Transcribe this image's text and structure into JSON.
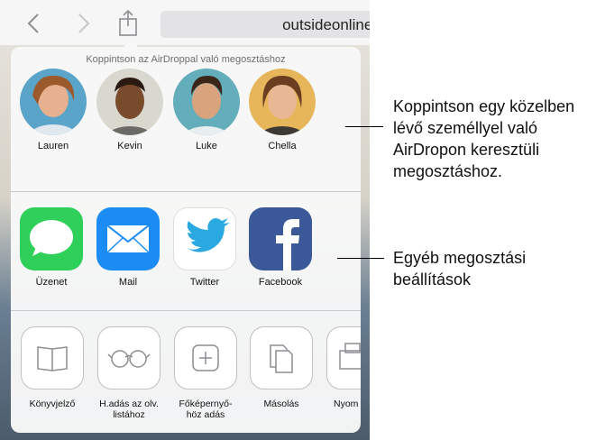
{
  "toolbar": {
    "url": "outsideonline.",
    "back_icon": "chevron-left-icon",
    "forward_icon": "chevron-right-icon",
    "share_icon": "share-icon"
  },
  "share_sheet": {
    "airdrop_hint": "Koppintson az AirDroppal való megosztáshoz",
    "people": [
      {
        "name": "Lauren"
      },
      {
        "name": "Kevin"
      },
      {
        "name": "Luke"
      },
      {
        "name": "Chella"
      }
    ],
    "apps": [
      {
        "label": "Üzenet",
        "icon": "messages-icon"
      },
      {
        "label": "Mail",
        "icon": "mail-icon"
      },
      {
        "label": "Twitter",
        "icon": "twitter-icon"
      },
      {
        "label": "Facebook",
        "icon": "facebook-icon"
      }
    ],
    "actions": [
      {
        "line1": "Könyvjelző",
        "line2": "",
        "icon": "book-icon"
      },
      {
        "line1": "H.adás az olv.",
        "line2": "listához",
        "icon": "glasses-icon"
      },
      {
        "line1": "Főképernyő-",
        "line2": "höz adás",
        "icon": "plus-square-icon"
      },
      {
        "line1": "Másolás",
        "line2": "",
        "icon": "copy-icon"
      },
      {
        "line1": "Nyom",
        "line2": "",
        "icon": "print-icon"
      }
    ]
  },
  "callouts": {
    "airdrop": [
      "Koppintson egy közelben",
      "lévő személlyel való",
      "AirDropon keresztüli",
      "megosztáshoz."
    ],
    "other": [
      "Egyéb megosztási",
      "beállítások"
    ]
  },
  "colors": {
    "messages": "#2fd05a",
    "mail": "#1a8cf3",
    "twitter": "#2aa9e0",
    "facebook": "#3b5998"
  }
}
